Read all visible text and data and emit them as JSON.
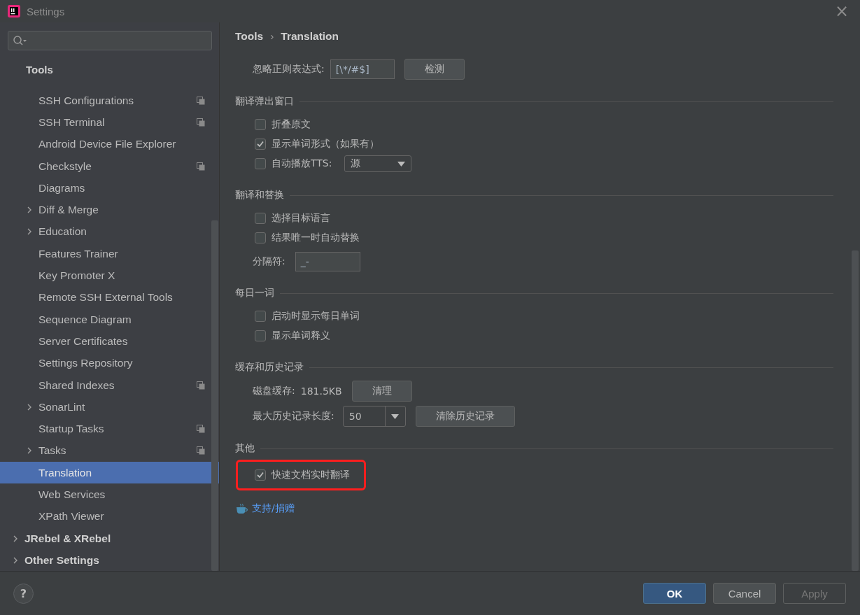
{
  "window": {
    "title": "Settings",
    "close": "×"
  },
  "sidebar": {
    "tree": [
      {
        "label": "Tools",
        "kind": "group",
        "expanded": true,
        "children": [
          {
            "label": "SSH Configurations",
            "kind": "page",
            "shared": true,
            "selected": false
          },
          {
            "label": "SSH Terminal",
            "kind": "page",
            "shared": true,
            "selected": false
          },
          {
            "label": "Android Device File Explorer",
            "kind": "page",
            "shared": false,
            "selected": false
          },
          {
            "label": "Checkstyle",
            "kind": "page",
            "shared": true,
            "selected": false
          },
          {
            "label": "Diagrams",
            "kind": "page",
            "shared": false,
            "selected": false
          },
          {
            "label": "Diff & Merge",
            "kind": "group",
            "expanded": false,
            "shared": false,
            "selected": false
          },
          {
            "label": "Education",
            "kind": "group",
            "expanded": false,
            "shared": false,
            "selected": false
          },
          {
            "label": "Features Trainer",
            "kind": "page",
            "shared": false,
            "selected": false
          },
          {
            "label": "Key Promoter X",
            "kind": "page",
            "shared": false,
            "selected": false
          },
          {
            "label": "Remote SSH External Tools",
            "kind": "page",
            "shared": false,
            "selected": false
          },
          {
            "label": "Sequence Diagram",
            "kind": "page",
            "shared": false,
            "selected": false
          },
          {
            "label": "Server Certificates",
            "kind": "page",
            "shared": false,
            "selected": false
          },
          {
            "label": "Settings Repository",
            "kind": "page",
            "shared": false,
            "selected": false
          },
          {
            "label": "Shared Indexes",
            "kind": "page",
            "shared": true,
            "selected": false
          },
          {
            "label": "SonarLint",
            "kind": "group",
            "expanded": false,
            "shared": false,
            "selected": false
          },
          {
            "label": "Startup Tasks",
            "kind": "page",
            "shared": true,
            "selected": false
          },
          {
            "label": "Tasks",
            "kind": "group",
            "expanded": false,
            "shared": true,
            "selected": false
          },
          {
            "label": "Translation",
            "kind": "page",
            "shared": false,
            "selected": true
          },
          {
            "label": "Web Services",
            "kind": "page",
            "shared": false,
            "selected": false
          },
          {
            "label": "XPath Viewer",
            "kind": "page",
            "shared": false,
            "selected": false
          }
        ]
      },
      {
        "label": "JRebel & XRebel",
        "kind": "group",
        "expanded": false,
        "shared": false,
        "selected": false
      },
      {
        "label": "Other Settings",
        "kind": "group",
        "expanded": false,
        "shared": false,
        "selected": false
      }
    ]
  },
  "breadcrumb": [
    "Tools",
    "Translation"
  ],
  "breadcrumb_separator": "›",
  "sections": [
    {
      "rows": [
        {
          "kind": "field",
          "label": "忽略正则表达式:",
          "value": "[\\*/#$]",
          "button": "检测"
        }
      ]
    },
    {
      "title": "翻译弹出窗口",
      "rows": [
        {
          "kind": "checkbox",
          "label": "折叠原文",
          "checked": false
        },
        {
          "kind": "checkbox",
          "label": "显示单词形式（如果有）",
          "checked": true
        },
        {
          "kind": "checkbox-select",
          "label": "自动播放TTS:",
          "checked": false,
          "value": "源"
        }
      ]
    },
    {
      "title": "翻译和替换",
      "rows": [
        {
          "kind": "checkbox",
          "label": "选择目标语言",
          "checked": false
        },
        {
          "kind": "checkbox",
          "label": "结果唯一时自动替换",
          "checked": false
        },
        {
          "kind": "field",
          "label": "分隔符:",
          "value": "_-"
        }
      ]
    },
    {
      "title": "每日一词",
      "rows": [
        {
          "kind": "checkbox",
          "label": "启动时显示每日单词",
          "checked": false
        },
        {
          "kind": "checkbox",
          "label": "显示单词释义",
          "checked": false
        }
      ]
    },
    {
      "title": "缓存和历史记录",
      "rows": [
        {
          "kind": "info",
          "label": "磁盘缓存:",
          "value": "181.5KB",
          "button": "清理"
        },
        {
          "kind": "combo",
          "label": "最大历史记录长度:",
          "value": "50",
          "button": "清除历史记录"
        }
      ]
    },
    {
      "title": "其他",
      "rows": [
        {
          "kind": "checkbox",
          "label": "快速文档实时翻译",
          "checked": true,
          "highlighted": true
        }
      ]
    }
  ],
  "link": "支持/捐赠",
  "footer": {
    "help": "?",
    "buttons": [
      {
        "label": "OK",
        "kind": "default",
        "disabled": false
      },
      {
        "label": "Cancel",
        "kind": "normal",
        "disabled": false
      },
      {
        "label": "Apply",
        "kind": "normal",
        "disabled": true
      }
    ]
  }
}
